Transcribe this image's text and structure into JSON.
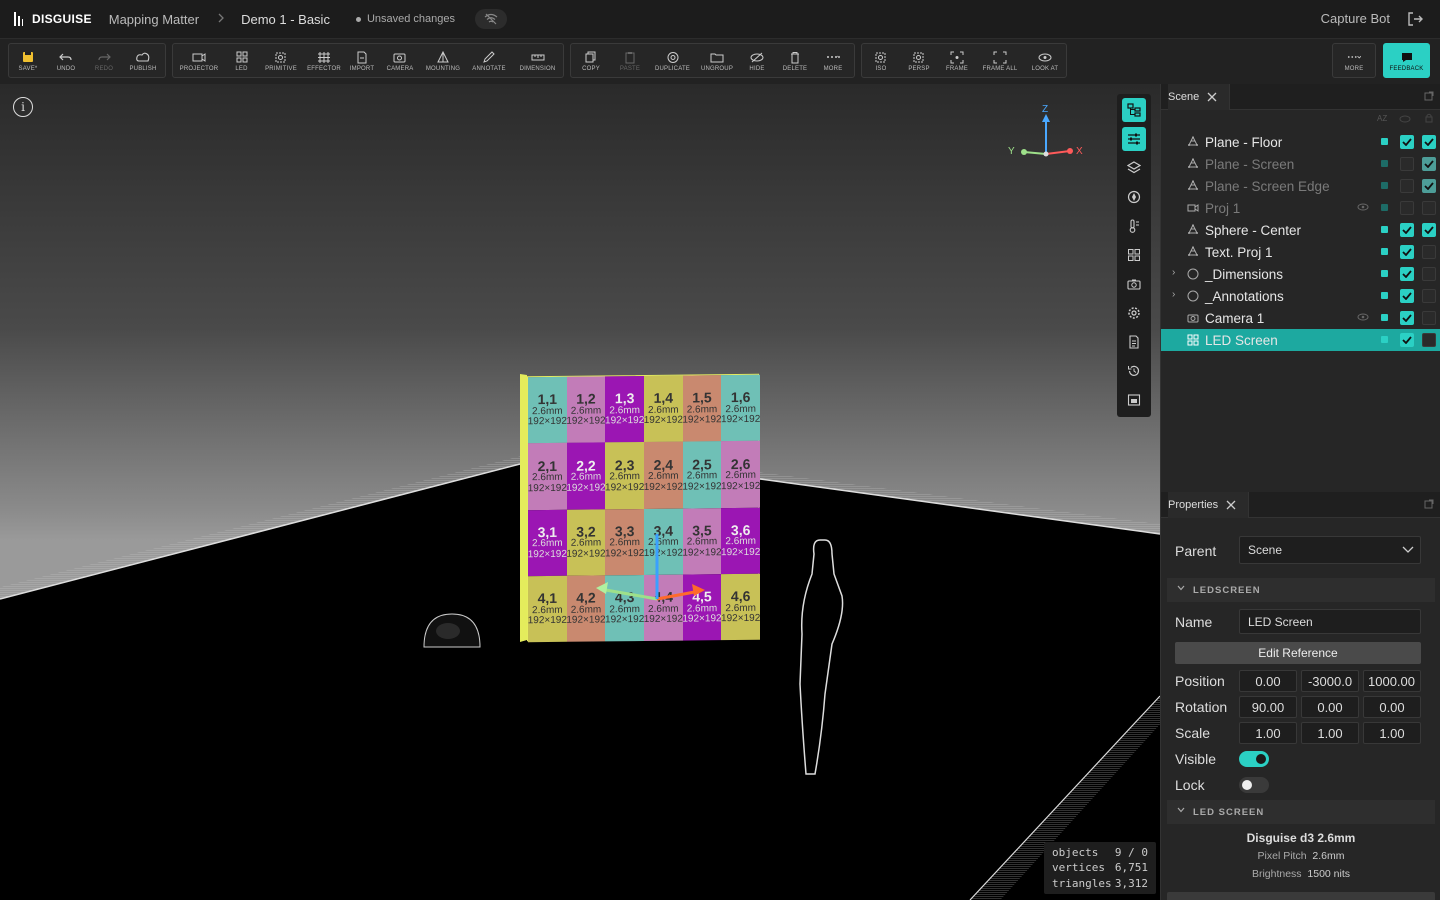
{
  "app": {
    "brand": "DISGUISE",
    "section": "Mapping Matter",
    "project": "Demo 1 - Basic",
    "status": "Unsaved changes",
    "user": "Capture Bot"
  },
  "toolbar": {
    "file": [
      "SAVE*",
      "UNDO",
      "REDO",
      "PUBLISH"
    ],
    "create": [
      "PROJECTOR",
      "LED",
      "PRIMITIVE",
      "EFFECTOR",
      "IMPORT",
      "CAMERA",
      "MOUNTING",
      "ANNOTATE",
      "DIMENSION"
    ],
    "edit": [
      "COPY",
      "PASTE",
      "DUPLICATE",
      "UNGROUP",
      "HIDE",
      "DELETE",
      "MORE"
    ],
    "view": [
      "ISO",
      "PERSP",
      "FRAME",
      "FRAME ALL",
      "LOOK AT"
    ],
    "more": "MORE",
    "feedback": "FEEDBACK"
  },
  "viewport": {
    "axes": {
      "z": "Z",
      "y": "Y",
      "x": "X"
    },
    "stats": [
      {
        "label": "objects",
        "value": "9 / 0"
      },
      {
        "label": "vertices",
        "value": "6,751"
      },
      {
        "label": "triangles",
        "value": "3,312"
      }
    ],
    "led_tiles": [
      {
        "id": "1,1",
        "pitch": "2.6mm",
        "res": "192×192",
        "color": "#6fc0b6"
      },
      {
        "id": "1,2",
        "pitch": "2.6mm",
        "res": "192×192",
        "color": "#c27cb8"
      },
      {
        "id": "1,3",
        "pitch": "2.6mm",
        "res": "192×192",
        "color": "#9b16b3"
      },
      {
        "id": "1,4",
        "pitch": "2.6mm",
        "res": "192×192",
        "color": "#c8c157"
      },
      {
        "id": "1,5",
        "pitch": "2.6mm",
        "res": "192×192",
        "color": "#c9896f"
      },
      {
        "id": "1,6",
        "pitch": "2.6mm",
        "res": "192×192",
        "color": "#6fc0b6"
      },
      {
        "id": "2,1",
        "pitch": "2.6mm",
        "res": "192×192",
        "color": "#c27cb8"
      },
      {
        "id": "2,2",
        "pitch": "2.6mm",
        "res": "192×192",
        "color": "#9b16b3"
      },
      {
        "id": "2,3",
        "pitch": "2.6mm",
        "res": "192×192",
        "color": "#c8c157"
      },
      {
        "id": "2,4",
        "pitch": "2.6mm",
        "res": "192×192",
        "color": "#c9896f"
      },
      {
        "id": "2,5",
        "pitch": "2.6mm",
        "res": "192×192",
        "color": "#6fc0b6"
      },
      {
        "id": "2,6",
        "pitch": "2.6mm",
        "res": "192×192",
        "color": "#c27cb8"
      },
      {
        "id": "3,1",
        "pitch": "2.6mm",
        "res": "192×192",
        "color": "#9b16b3"
      },
      {
        "id": "3,2",
        "pitch": "2.6mm",
        "res": "192×192",
        "color": "#c8c157"
      },
      {
        "id": "3,3",
        "pitch": "2.6mm",
        "res": "192×192",
        "color": "#c9896f"
      },
      {
        "id": "3,4",
        "pitch": "2.6mm",
        "res": "192×192",
        "color": "#6fc0b6"
      },
      {
        "id": "3,5",
        "pitch": "2.6mm",
        "res": "192×192",
        "color": "#c27cb8"
      },
      {
        "id": "3,6",
        "pitch": "2.6mm",
        "res": "192×192",
        "color": "#9b16b3"
      },
      {
        "id": "4,1",
        "pitch": "2.6mm",
        "res": "192×192",
        "color": "#c8c157"
      },
      {
        "id": "4,2",
        "pitch": "2.6mm",
        "res": "192×192",
        "color": "#c9896f"
      },
      {
        "id": "4,3",
        "pitch": "2.6mm",
        "res": "192×192",
        "color": "#6fc0b6"
      },
      {
        "id": "4,4",
        "pitch": "2.6mm",
        "res": "192×192",
        "color": "#c27cb8"
      },
      {
        "id": "4,5",
        "pitch": "2.6mm",
        "res": "192×192",
        "color": "#9b16b3"
      },
      {
        "id": "4,6",
        "pitch": "2.6mm",
        "res": "192×192",
        "color": "#c8c157"
      }
    ]
  },
  "scene": {
    "title": "Scene",
    "sort_label": "AZ",
    "items": [
      {
        "name": "Plane - Floor",
        "icon": "mesh-icon",
        "dim": false,
        "vis": true,
        "lock": true,
        "eye": false,
        "expand": false,
        "selected": false
      },
      {
        "name": "Plane - Screen",
        "icon": "mesh-icon",
        "dim": true,
        "vis": false,
        "lock": true,
        "eye": false,
        "expand": false,
        "selected": false
      },
      {
        "name": "Plane - Screen Edge",
        "icon": "mesh-icon",
        "dim": true,
        "vis": false,
        "lock": true,
        "eye": false,
        "expand": false,
        "selected": false
      },
      {
        "name": "Proj 1",
        "icon": "projector-icon",
        "dim": true,
        "vis": false,
        "lock": false,
        "eye": true,
        "expand": false,
        "selected": false
      },
      {
        "name": "Sphere - Center",
        "icon": "mesh-icon",
        "dim": false,
        "vis": true,
        "lock": true,
        "eye": false,
        "expand": false,
        "selected": false
      },
      {
        "name": "Text. Proj 1",
        "icon": "mesh-icon",
        "dim": false,
        "vis": true,
        "lock": false,
        "eye": false,
        "expand": false,
        "selected": false
      },
      {
        "name": "_Dimensions",
        "icon": "group-icon",
        "dim": false,
        "vis": true,
        "lock": false,
        "eye": false,
        "expand": true,
        "selected": false
      },
      {
        "name": "_Annotations",
        "icon": "group-icon",
        "dim": false,
        "vis": true,
        "lock": false,
        "eye": false,
        "expand": true,
        "selected": false
      },
      {
        "name": "Camera 1",
        "icon": "camera-icon",
        "dim": false,
        "vis": true,
        "lock": false,
        "eye": true,
        "expand": false,
        "selected": false
      },
      {
        "name": "LED Screen",
        "icon": "led-icon",
        "dim": false,
        "vis": true,
        "lock": false,
        "eye": false,
        "expand": false,
        "selected": true
      }
    ]
  },
  "properties": {
    "title": "Properties",
    "parent_label": "Parent",
    "parent_value": "Scene",
    "section_ledscreen": "LEDSCREEN",
    "name_label": "Name",
    "name_value": "LED Screen",
    "edit_reference": "Edit Reference",
    "position_label": "Position",
    "position": [
      "0.00",
      "-3000.0",
      "1000.00"
    ],
    "rotation_label": "Rotation",
    "rotation": [
      "90.00",
      "0.00",
      "0.00"
    ],
    "scale_label": "Scale",
    "scale": [
      "1.00",
      "1.00",
      "1.00"
    ],
    "visible_label": "Visible",
    "visible": true,
    "lock_label": "Lock",
    "lock": false,
    "section_led": "LED SCREEN",
    "led_model": "Disguise d3 2.6mm",
    "pixel_pitch_label": "Pixel Pitch",
    "pixel_pitch": "2.6mm",
    "brightness_label": "Brightness",
    "brightness": "1500 nits"
  },
  "colors": {
    "accent": "#2bd0c4",
    "save": "#f0c030"
  }
}
